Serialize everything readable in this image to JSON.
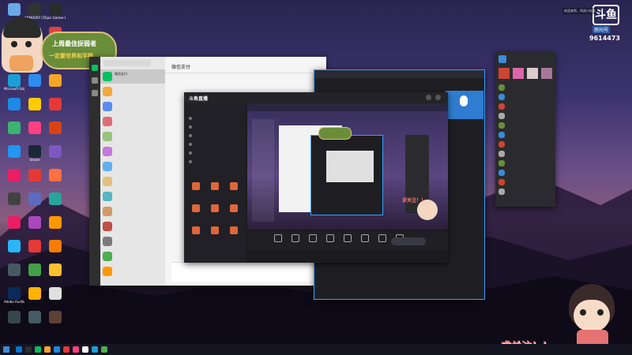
{
  "overlay": {
    "banner_line1": "上周最佳捉弱者",
    "banner_line2": "一定要世界和平啊",
    "follow_text": "求关注！！",
    "topright_notice": "欢迎来到，阿虎小仙女",
    "platform_logo_text": "斗鱼",
    "room_label": "房间号",
    "room_number": "9614473"
  },
  "desktop": {
    "icons": [
      {
        "label": "",
        "color": "#6aa8e8"
      },
      {
        "label": "ARMOURY CRATE",
        "color": "#333333"
      },
      {
        "label": "Epic Games Launcher",
        "color": "#2a2a2a"
      },
      {
        "label": "",
        "color": "#3a78c8"
      },
      {
        "label": "",
        "color": "#4488cc"
      },
      {
        "label": "",
        "color": "#e04040"
      },
      {
        "label": "",
        "color": "#e8e8e8"
      },
      {
        "label": "",
        "color": "#1e90ff"
      },
      {
        "label": "",
        "color": "#ff5a5a"
      },
      {
        "label": "Microsoft Edge",
        "color": "#1a9ed8"
      },
      {
        "label": "",
        "color": "#2d8cf0"
      },
      {
        "label": "",
        "color": "#f5a623"
      },
      {
        "label": "",
        "color": "#1e88e5"
      },
      {
        "label": "",
        "color": "#ffcc00"
      },
      {
        "label": "",
        "color": "#e53935"
      },
      {
        "label": "",
        "color": "#3cb371"
      },
      {
        "label": "",
        "color": "#ff4081"
      },
      {
        "label": "",
        "color": "#d84315"
      },
      {
        "label": "",
        "color": "#2196f3"
      },
      {
        "label": "Steam",
        "color": "#1b2838"
      },
      {
        "label": "",
        "color": "#7e57c2"
      },
      {
        "label": "",
        "color": "#e91e63"
      },
      {
        "label": "",
        "color": "#e53935"
      },
      {
        "label": "",
        "color": "#ff7043"
      },
      {
        "label": "",
        "color": "#424242"
      },
      {
        "label": "",
        "color": "#5c6bc0"
      },
      {
        "label": "",
        "color": "#26a69a"
      },
      {
        "label": "",
        "color": "#e91e63"
      },
      {
        "label": "",
        "color": "#ab47bc"
      },
      {
        "label": "",
        "color": "#ff9800"
      },
      {
        "label": "",
        "color": "#29b6f6"
      },
      {
        "label": "",
        "color": "#e53935"
      },
      {
        "label": "",
        "color": "#f57c00"
      },
      {
        "label": "",
        "color": "#455a64"
      },
      {
        "label": "",
        "color": "#43a047"
      },
      {
        "label": "",
        "color": "#fbc02d"
      },
      {
        "label": "Adobe Audition",
        "color": "#0a2a5a"
      },
      {
        "label": "",
        "color": "#ffb300"
      },
      {
        "label": "",
        "color": "#e0e0e0"
      },
      {
        "label": "",
        "color": "#37474f"
      },
      {
        "label": "",
        "color": "#455a64"
      },
      {
        "label": "",
        "color": "#5d4037"
      }
    ]
  },
  "wechat": {
    "title": "微信支付",
    "chats": [
      {
        "name": "微信支付",
        "preview": "",
        "color": "#07c160"
      },
      {
        "name": "",
        "preview": "",
        "color": "#f2a93b"
      },
      {
        "name": "",
        "preview": "",
        "color": "#5b8def"
      },
      {
        "name": "",
        "preview": "",
        "color": "#e06c75"
      },
      {
        "name": "",
        "preview": "",
        "color": "#98c379"
      },
      {
        "name": "",
        "preview": "",
        "color": "#c678dd"
      },
      {
        "name": "",
        "preview": "",
        "color": "#61afef"
      },
      {
        "name": "",
        "preview": "",
        "color": "#e5c07b"
      },
      {
        "name": "",
        "preview": "",
        "color": "#56b6c2"
      },
      {
        "name": "",
        "preview": "",
        "color": "#d19a66"
      },
      {
        "name": "",
        "preview": "",
        "color": "#be5046"
      },
      {
        "name": "",
        "preview": "",
        "color": "#7a7a7a"
      },
      {
        "name": "",
        "preview": "",
        "color": "#4caf50"
      },
      {
        "name": "",
        "preview": "",
        "color": "#ff9800"
      }
    ],
    "msg1": "",
    "msg2": ""
  },
  "blue_window": {
    "title": ""
  },
  "right_panel": {
    "title": "",
    "voice_label": "",
    "list": [
      "",
      "",
      "",
      "",
      "",
      "",
      "",
      "",
      "",
      "",
      "",
      ""
    ]
  },
  "douyu_app": {
    "brand": "斗鱼直播",
    "title": "",
    "toolbar": [
      "",
      "",
      "",
      "",
      "",
      "",
      "",
      ""
    ],
    "left_sections": [
      "",
      "",
      "",
      "",
      "",
      ""
    ],
    "input_placeholder": ""
  },
  "mini_window": {
    "follow_text": "求关注！！"
  },
  "taskbar": {
    "time": "",
    "apps": [
      "#0078d4",
      "#2d2d2d",
      "#07c160",
      "#f5a623",
      "#1e88e5",
      "#e53935",
      "#ff4081",
      "#ffffff",
      "#1a9ed8",
      "#4caf50"
    ]
  }
}
